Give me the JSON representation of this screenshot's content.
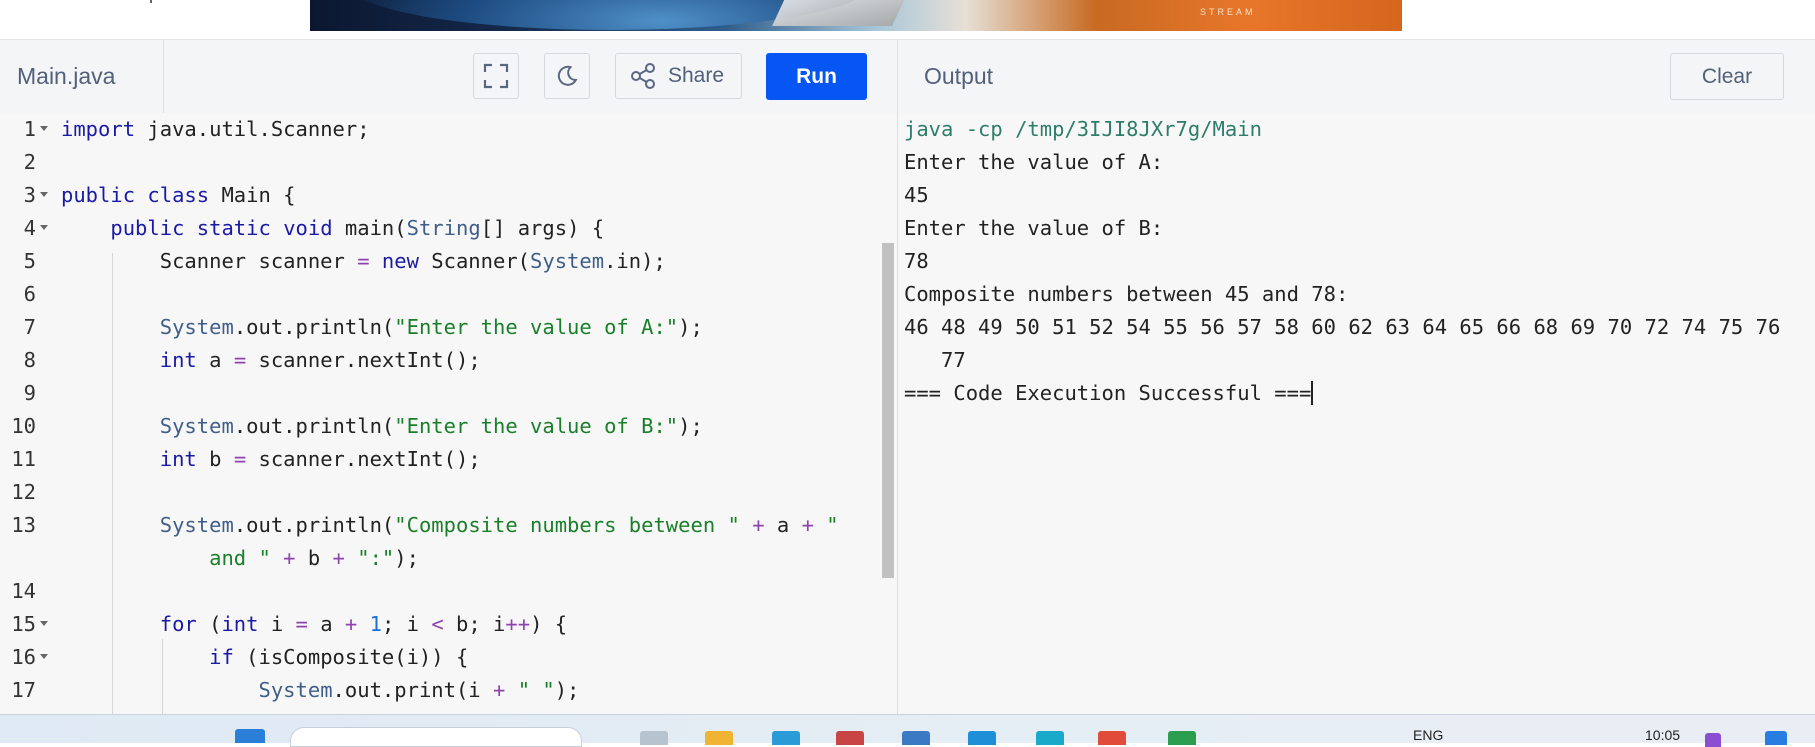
{
  "window": {
    "file_tab": "Main.java",
    "output_title": "Output"
  },
  "toolbar": {
    "fullscreen_icon": "fullscreen-icon",
    "theme_icon": "moon-icon",
    "share_label": "Share",
    "run_label": "Run",
    "clear_label": "Clear"
  },
  "banner": {
    "text": "STREAM"
  },
  "editor": {
    "line_numbers": [
      "1",
      "2",
      "3",
      "4",
      "5",
      "6",
      "7",
      "8",
      "9",
      "10",
      "11",
      "12",
      "13",
      "",
      "14",
      "15",
      "16",
      "17"
    ]
  },
  "output": {
    "lines": [
      "java -cp /tmp/3IJI8JXr7g/Main",
      "Enter the value of A:",
      "45",
      "Enter the value of B:",
      "78",
      "Composite numbers between 45 and 78:",
      "46 48 49 50 51 52 54 55 56 57 58 60 62 63 64 65 66 68 69 70 72 74 75 76",
      "   77",
      "=== Code Execution Successful ==="
    ]
  },
  "taskbar": {
    "lang": "ENG",
    "time": "10:05"
  }
}
